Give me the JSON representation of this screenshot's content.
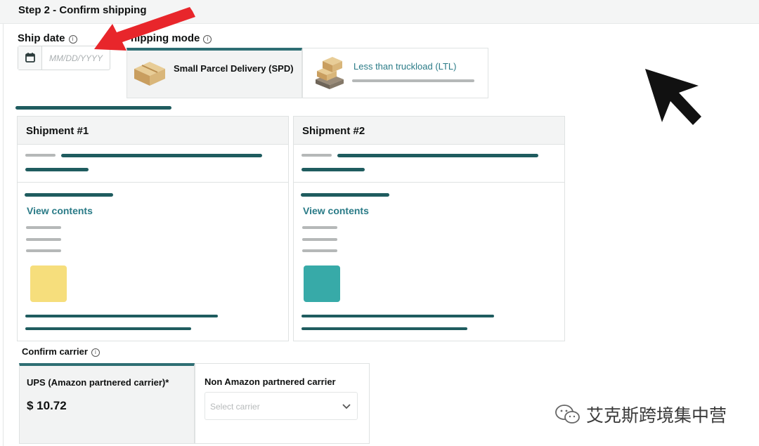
{
  "step": {
    "title": "Step 2 - Confirm shipping"
  },
  "ship_date": {
    "label": "Ship date",
    "placeholder": "MM/DD/YYYY"
  },
  "shipping_mode": {
    "label": "Shipping mode",
    "label_visible": "hipping mode",
    "options": [
      {
        "label": "Small Parcel Delivery (SPD)",
        "selected": true
      },
      {
        "label": "Less than truckload (LTL)",
        "selected": false
      }
    ]
  },
  "shipments": [
    {
      "title": "Shipment #1",
      "link": "View contents",
      "swatch_color": "#f6de7c"
    },
    {
      "title": "Shipment #2",
      "link": "View contents",
      "swatch_color": "#37aaa8"
    }
  ],
  "carrier": {
    "label": "Confirm carrier",
    "options": [
      {
        "label": "UPS (Amazon partnered carrier)*",
        "price": "$ 10.72",
        "selected": true
      },
      {
        "label": "Non Amazon partnered carrier",
        "select_placeholder": "Select carrier",
        "selected": false
      }
    ]
  },
  "watermark": {
    "text": "艾克斯跨境集中营"
  },
  "colors": {
    "accent": "#1f5c5f",
    "link": "#2a7b87",
    "annotation_arrow": "#e8262b",
    "cursor": "#111111"
  },
  "icons": [
    "calendar-icon",
    "info-icon",
    "box-icon",
    "pallet-icon",
    "chevron-down-icon",
    "wechat-icon",
    "cursor-icon",
    "annotation-arrow"
  ]
}
